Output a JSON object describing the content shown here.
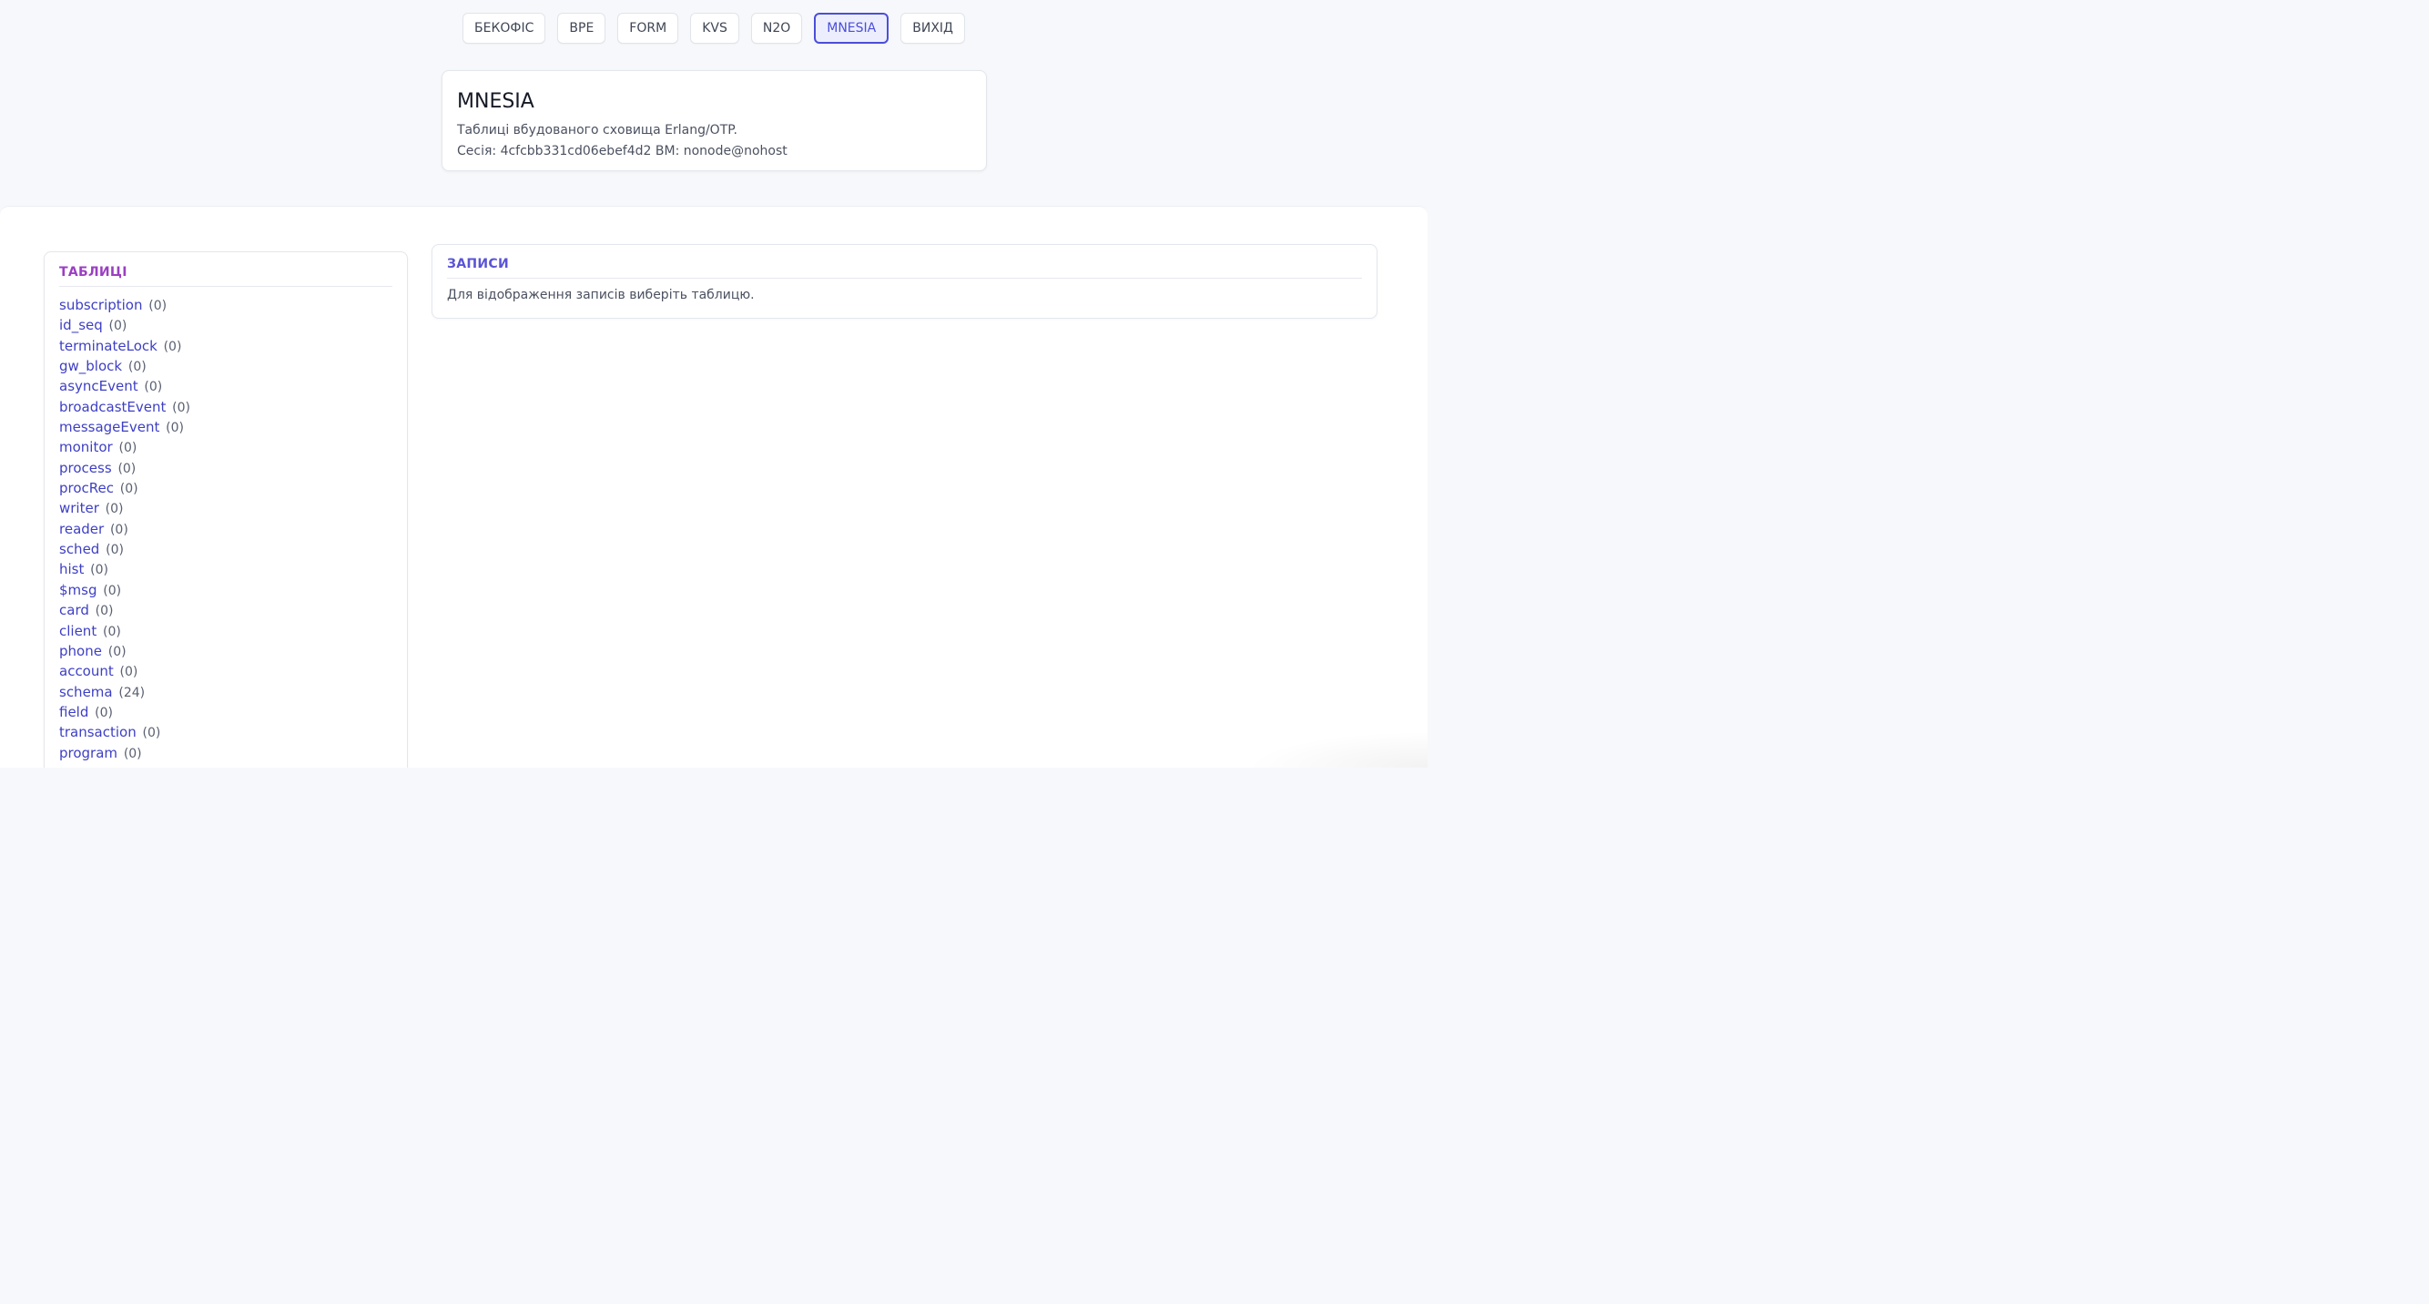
{
  "nav": {
    "items": [
      {
        "label": "БЕКОФІС",
        "active": false
      },
      {
        "label": "BPE",
        "active": false
      },
      {
        "label": "FORM",
        "active": false
      },
      {
        "label": "KVS",
        "active": false
      },
      {
        "label": "N2O",
        "active": false
      },
      {
        "label": "MNESIA",
        "active": true
      },
      {
        "label": "ВИХІД",
        "active": false
      }
    ]
  },
  "header": {
    "title": "MNESIA",
    "description": "Таблиці вбудованого сховища Erlang/OTP.",
    "session_line": "Сесія: 4cfcbb331cd06ebef4d2 ВМ: nonode@nohost"
  },
  "tables_panel": {
    "heading": "ТАБЛИЦІ",
    "items": [
      {
        "name": "subscription",
        "count": "(0)"
      },
      {
        "name": "id_seq",
        "count": "(0)"
      },
      {
        "name": "terminateLock",
        "count": "(0)"
      },
      {
        "name": "gw_block",
        "count": "(0)"
      },
      {
        "name": "asyncEvent",
        "count": "(0)"
      },
      {
        "name": "broadcastEvent",
        "count": "(0)"
      },
      {
        "name": "messageEvent",
        "count": "(0)"
      },
      {
        "name": "monitor",
        "count": "(0)"
      },
      {
        "name": "process",
        "count": "(0)"
      },
      {
        "name": "procRec",
        "count": "(0)"
      },
      {
        "name": "writer",
        "count": "(0)"
      },
      {
        "name": "reader",
        "count": "(0)"
      },
      {
        "name": "sched",
        "count": "(0)"
      },
      {
        "name": "hist",
        "count": "(0)"
      },
      {
        "name": "$msg",
        "count": "(0)"
      },
      {
        "name": "card",
        "count": "(0)"
      },
      {
        "name": "client",
        "count": "(0)"
      },
      {
        "name": "phone",
        "count": "(0)"
      },
      {
        "name": "account",
        "count": "(0)"
      },
      {
        "name": "schema",
        "count": "(24)"
      },
      {
        "name": "field",
        "count": "(0)"
      },
      {
        "name": "transaction",
        "count": "(0)"
      },
      {
        "name": "program",
        "count": "(0)"
      }
    ]
  },
  "records_panel": {
    "heading": "ЗАПИСИ",
    "empty_message": "Для відображення записів виберіть таблицю."
  },
  "colors": {
    "accent": "#4b4fd8",
    "tables_heading": "#9b3fc2",
    "records_heading": "#5a54d6",
    "link": "#3d3fc4",
    "background": "#f7f8fb"
  }
}
